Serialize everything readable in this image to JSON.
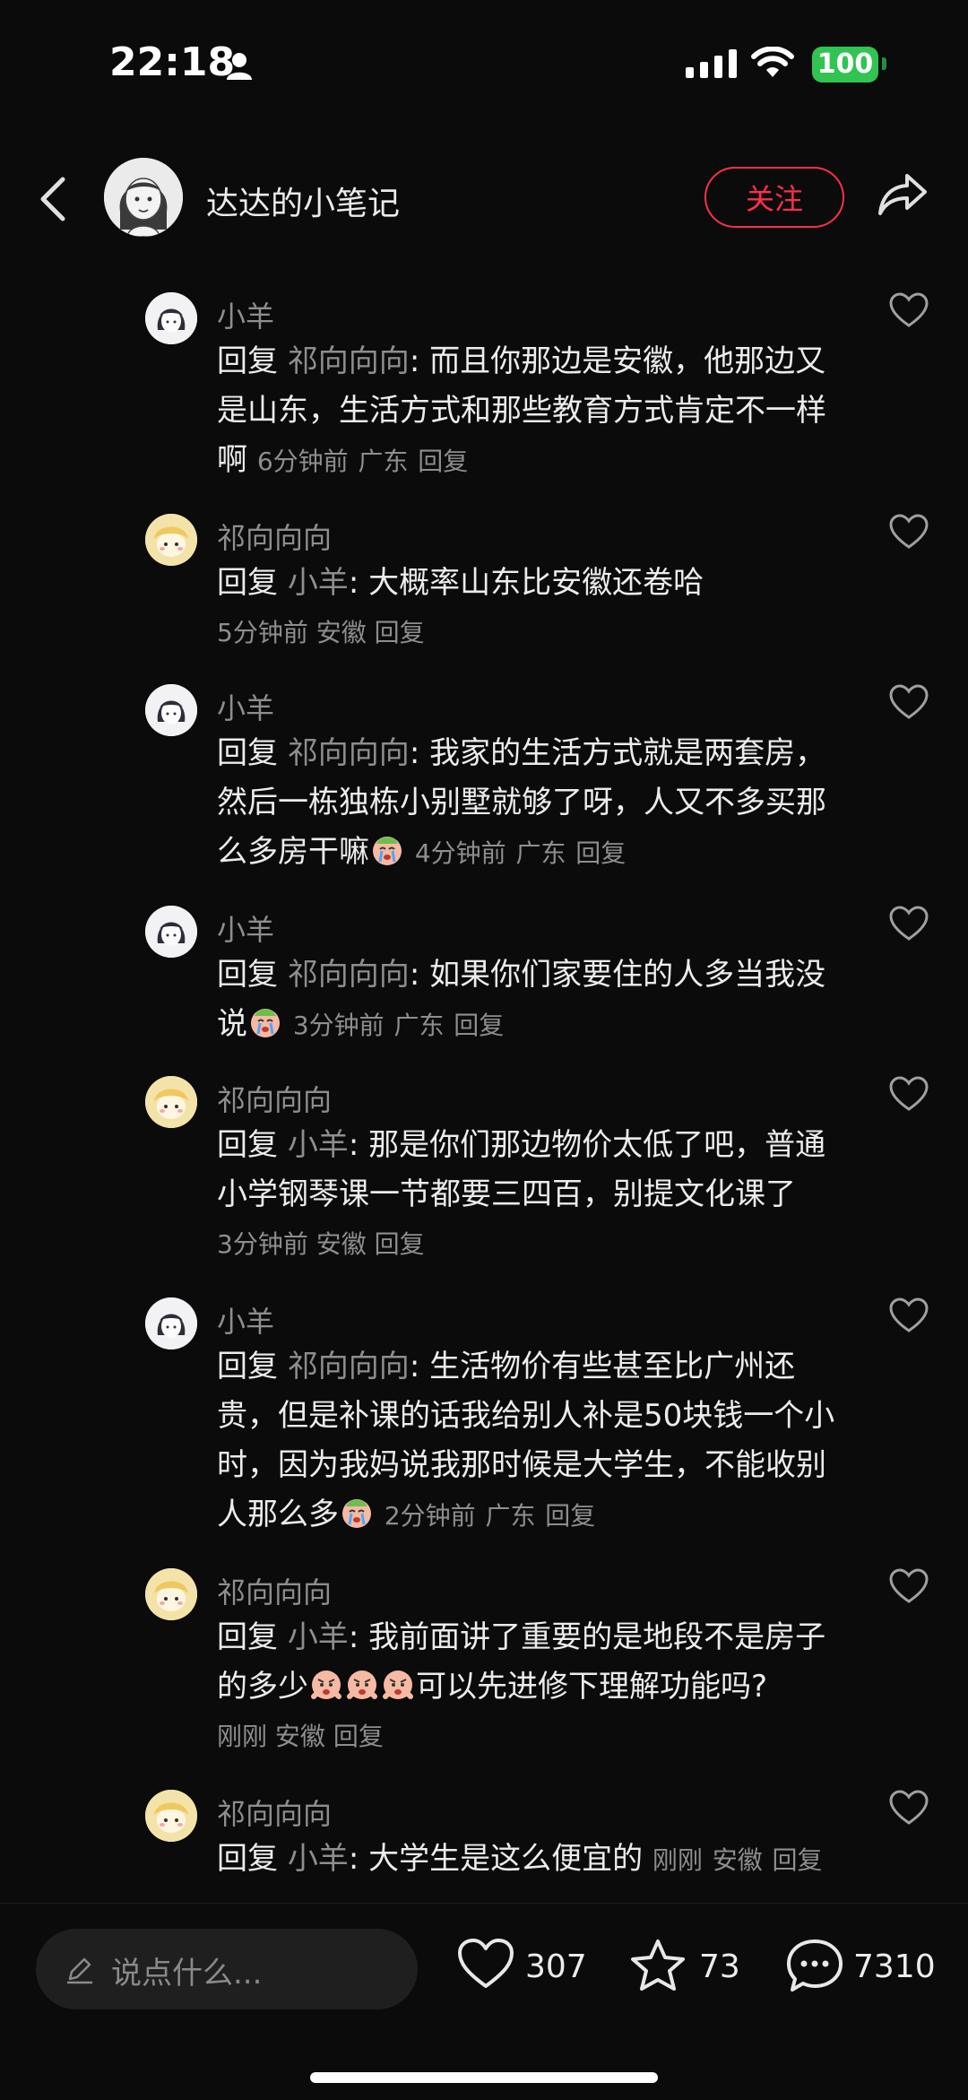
{
  "status_bar": {
    "time": "22:18",
    "battery": "100"
  },
  "header": {
    "title": "达达的小笔记",
    "follow": "关注"
  },
  "comments": [
    {
      "name": "小羊",
      "avatar": "sheep",
      "reply_word": "回复",
      "reply_to": "祁向向向",
      "text": "而且你那边是安徽，他那边又是山东，生活方式和那些教育方式肯定不一样啊",
      "time": "6分钟前",
      "location": "广东",
      "reply": "回复"
    },
    {
      "name": "祁向向向",
      "avatar": "qi",
      "reply_word": "回复",
      "reply_to": "小羊",
      "text": "大概率山东比安徽还卷哈",
      "time": "5分钟前",
      "location": "安徽",
      "reply": "回复"
    },
    {
      "name": "小羊",
      "avatar": "sheep",
      "reply_word": "回复",
      "reply_to": "祁向向向",
      "text": "我家的生活方式就是两套房，然后一栋独栋小别墅就够了呀，人又不多买那么多房干嘛",
      "time": "4分钟前",
      "location": "广东",
      "reply": "回复"
    },
    {
      "name": "小羊",
      "avatar": "sheep",
      "reply_word": "回复",
      "reply_to": "祁向向向",
      "text": "如果你们家要住的人多当我没说",
      "time": "3分钟前",
      "location": "广东",
      "reply": "回复"
    },
    {
      "name": "祁向向向",
      "avatar": "qi",
      "reply_word": "回复",
      "reply_to": "小羊",
      "text": "那是你们那边物价太低了吧，普通小学钢琴课一节都要三四百，别提文化课了",
      "time": "3分钟前",
      "location": "安徽",
      "reply": "回复"
    },
    {
      "name": "小羊",
      "avatar": "sheep",
      "reply_word": "回复",
      "reply_to": "祁向向向",
      "text": "生活物价有些甚至比广州还贵，但是补课的话我给别人补是50块钱一个小时，因为我妈说我那时候是大学生，不能收别人那么多",
      "time": "2分钟前",
      "location": "广东",
      "reply": "回复"
    },
    {
      "name": "祁向向向",
      "avatar": "qi",
      "reply_word": "回复",
      "reply_to": "小羊",
      "text": "我前面讲了重要的是地段不是房子的多少",
      "text_after": "可以先进修下理解功能吗?",
      "time": "刚刚",
      "location": "安徽",
      "reply": "回复"
    },
    {
      "name": "祁向向向",
      "avatar": "qi",
      "reply_word": "回复",
      "reply_to": "小羊",
      "text": "大学生是这么便宜的",
      "time": "刚刚",
      "location": "安徽",
      "reply": "回复"
    }
  ],
  "bottom_bar": {
    "input_placeholder": "说点什么...",
    "likes": "307",
    "stars": "73",
    "comments": "7310"
  },
  "colors": {
    "accent": "#ff2e4d",
    "battery": "#31c451",
    "muted": "#8e8e8e"
  }
}
